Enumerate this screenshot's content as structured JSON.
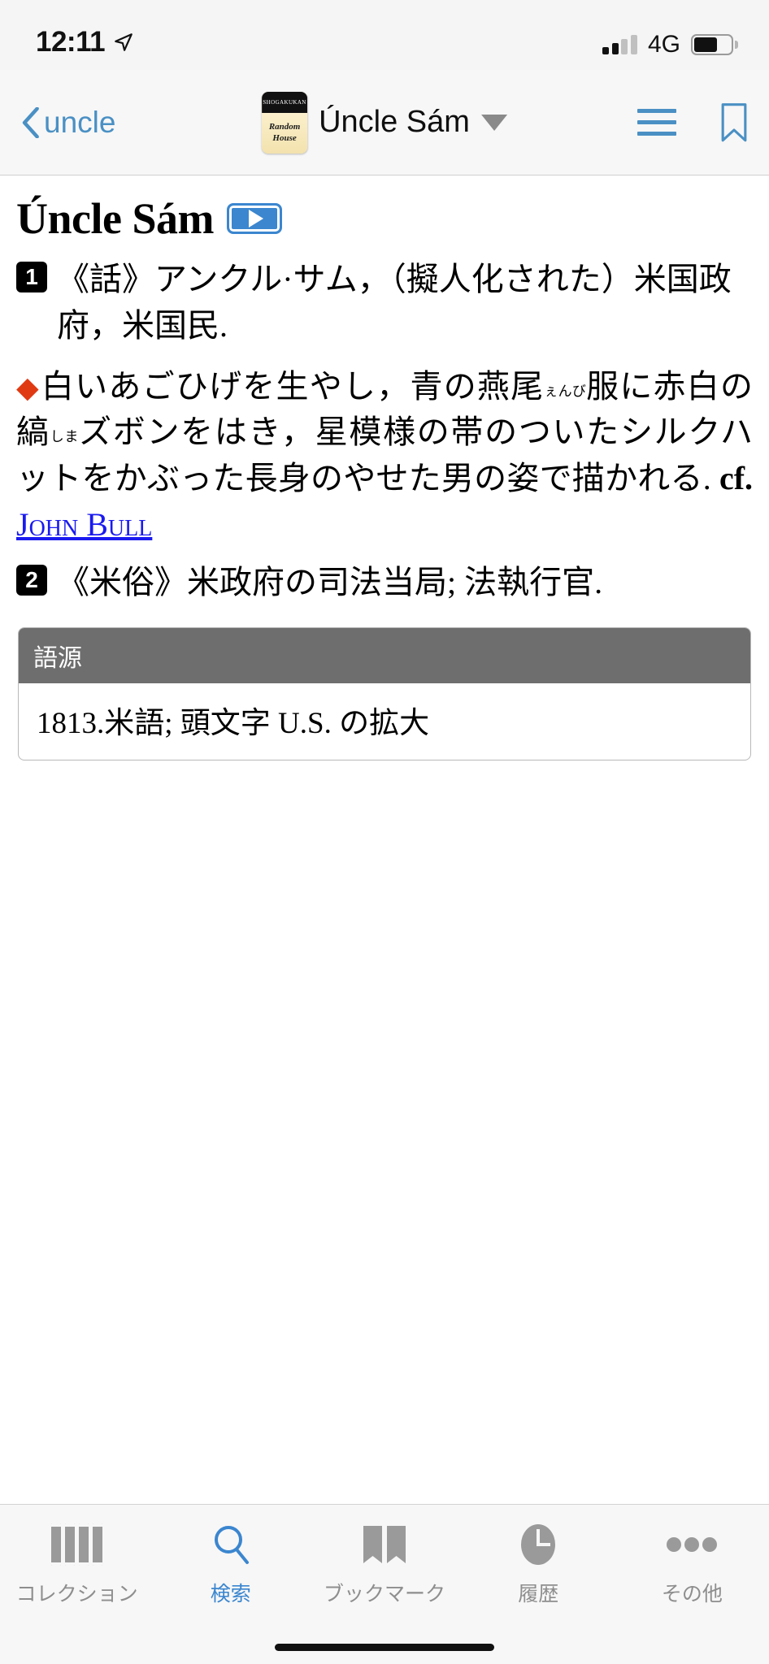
{
  "status_bar": {
    "time": "12:11",
    "location_icon": "location-arrow-icon",
    "signal_icon": "cellular-signal-icon",
    "signal_bars_filled": 2,
    "signal_bars_total": 4,
    "carrier": "4G",
    "battery_icon": "battery-icon",
    "battery_percent": 65
  },
  "nav_bar": {
    "back_icon": "chevron-left-icon",
    "back_label": "uncle",
    "dictionary_icon": "dictionary-book-icon",
    "dictionary_publisher": "SHOGAKUKAN",
    "dictionary_line1": "Random",
    "dictionary_line2": "House",
    "title": "Úncle Sám",
    "dropdown_icon": "caret-down-icon",
    "menu_icon": "hamburger-menu-icon",
    "bookmark_icon": "bookmark-outline-icon",
    "accent_color": "#4a90c4"
  },
  "entry": {
    "headword": "Úncle Sám",
    "audio_icon": "play-audio-icon",
    "senses": [
      {
        "number": "1",
        "text": "《話》アンクル·サム，（擬人化された）米国政府，米国民."
      },
      {
        "number": "2",
        "text": "《米俗》米政府の司法当局; 法執行官."
      }
    ],
    "note": {
      "marker_icon": "red-diamond-icon",
      "marker_color": "#e03a13",
      "part1": "白いあごひげを生やし，青の燕尾",
      "ruby1": "ぇんび",
      "part2": "服に赤白の縞",
      "ruby2": "しま",
      "part3": "ズボンをはき，星模様の帯のついたシルクハットをかぶった長身のやせた男の姿で描かれる.",
      "cf_label": "cf.",
      "cross_reference": "John Bull",
      "cross_reference_color": "#1a1af0"
    },
    "etymology": {
      "header": "語源",
      "header_bg": "#6e6e6e",
      "body": "1813.米語; 頭文字 U.S. の拡大"
    }
  },
  "tab_bar": {
    "active_index": 1,
    "active_color": "#3b86cf",
    "inactive_color": "#8e8e8e",
    "tabs": [
      {
        "label": "コレクション",
        "icon": "books-collection-icon"
      },
      {
        "label": "検索",
        "icon": "search-magnifier-icon"
      },
      {
        "label": "ブックマーク",
        "icon": "open-book-bookmark-icon"
      },
      {
        "label": "履歴",
        "icon": "clock-history-icon"
      },
      {
        "label": "その他",
        "icon": "more-dots-icon"
      }
    ]
  }
}
